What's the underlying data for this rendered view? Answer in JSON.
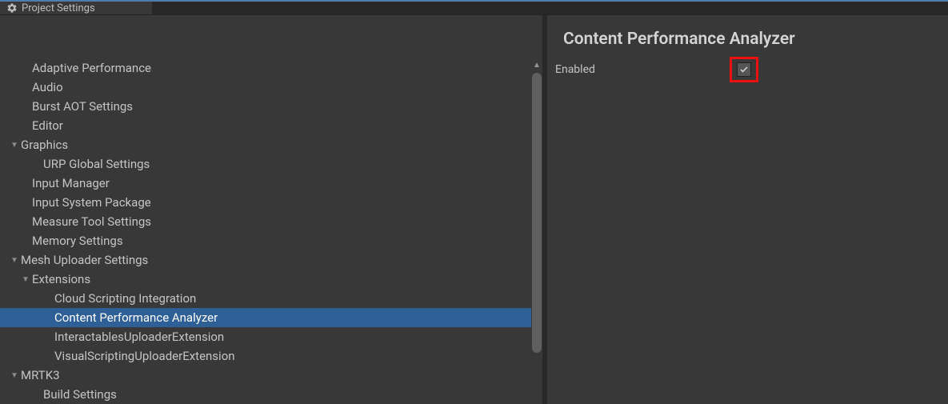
{
  "tab": {
    "label": "Project Settings"
  },
  "sidebar": {
    "items": [
      {
        "label": "Adaptive Performance",
        "indent": 1,
        "arrow": false,
        "selected": false
      },
      {
        "label": "Audio",
        "indent": 1,
        "arrow": false,
        "selected": false
      },
      {
        "label": "Burst AOT Settings",
        "indent": 1,
        "arrow": false,
        "selected": false
      },
      {
        "label": "Editor",
        "indent": 1,
        "arrow": false,
        "selected": false
      },
      {
        "label": "Graphics",
        "indent": 0,
        "arrow": true,
        "selected": false
      },
      {
        "label": "URP Global Settings",
        "indent": 2,
        "arrow": false,
        "selected": false
      },
      {
        "label": "Input Manager",
        "indent": 1,
        "arrow": false,
        "selected": false
      },
      {
        "label": "Input System Package",
        "indent": 1,
        "arrow": false,
        "selected": false
      },
      {
        "label": "Measure Tool Settings",
        "indent": 1,
        "arrow": false,
        "selected": false
      },
      {
        "label": "Memory Settings",
        "indent": 1,
        "arrow": false,
        "selected": false
      },
      {
        "label": "Mesh Uploader Settings",
        "indent": 0,
        "arrow": true,
        "selected": false
      },
      {
        "label": "Extensions",
        "indent": 1,
        "arrow": true,
        "selected": false
      },
      {
        "label": "Cloud Scripting Integration",
        "indent": 3,
        "arrow": false,
        "selected": false
      },
      {
        "label": "Content Performance Analyzer",
        "indent": 3,
        "arrow": false,
        "selected": true
      },
      {
        "label": "InteractablesUploaderExtension",
        "indent": 3,
        "arrow": false,
        "selected": false
      },
      {
        "label": "VisualScriptingUploaderExtension",
        "indent": 3,
        "arrow": false,
        "selected": false
      },
      {
        "label": "MRTK3",
        "indent": 0,
        "arrow": true,
        "selected": false
      },
      {
        "label": "Build Settings",
        "indent": 2,
        "arrow": false,
        "selected": false
      }
    ]
  },
  "detail": {
    "title": "Content Performance Analyzer",
    "enabled_label": "Enabled",
    "enabled_checked": true
  }
}
